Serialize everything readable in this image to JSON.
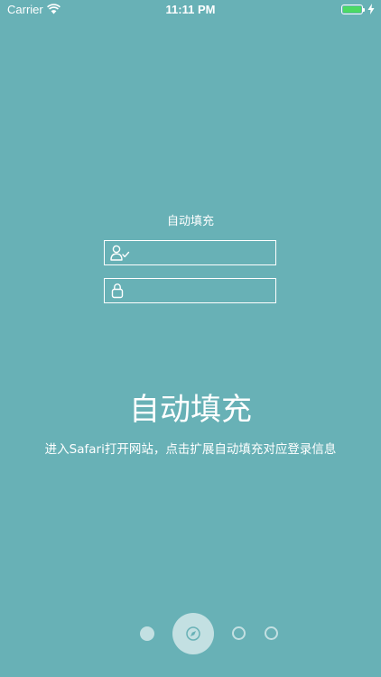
{
  "status_bar": {
    "carrier": "Carrier",
    "time": "11:11 PM",
    "battery_color": "#4cd964"
  },
  "form": {
    "title": "自动填充",
    "username_icon": "user-check-icon",
    "password_icon": "lock-icon"
  },
  "hero": {
    "title": "自动填充",
    "subtitle": "进入Safari打开网站，点击扩展自动填充对应登录信息"
  },
  "pager": {
    "current_page": 2,
    "total_pages": 4,
    "active_icon": "compass-icon"
  },
  "colors": {
    "background": "#68b1b6",
    "indicator": "#c3e0e2",
    "foreground": "#ffffff"
  }
}
